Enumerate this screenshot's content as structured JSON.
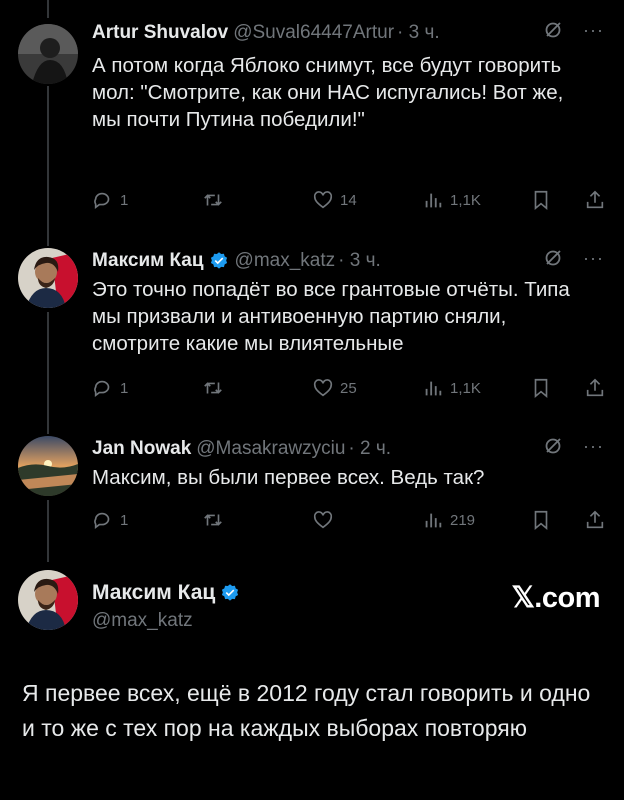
{
  "tweets": [
    {
      "name": "Artur Shuvalov",
      "handle": "@Suval64447Artur",
      "time": "· 3 ч.",
      "text": "А потом когда Яблоко снимут, все будут говорить мол: \"Смотрите, как они НАС испугались! Вот же, мы почти Путина победили!\"",
      "replies": "1",
      "retweets": "",
      "likes": "14",
      "views": "1,1K"
    },
    {
      "name": "Максим Кац",
      "handle": "@max_katz",
      "time": "· 3 ч.",
      "text": "Это точно попадёт во все грантовые отчёты. Типа мы призвали и антивоенную партию сняли, смотрите какие мы влиятельные",
      "replies": "1",
      "retweets": "",
      "likes": "25",
      "views": "1,1K"
    },
    {
      "name": "Jan Nowak",
      "handle": "@Masakrawzyciu",
      "time": "· 2 ч.",
      "text": "Максим, вы были первее всех. Ведь так?",
      "replies": "1",
      "retweets": "",
      "likes": "",
      "views": "219"
    }
  ],
  "main_tweet": {
    "name": "Максим Кац",
    "handle": "@max_katz",
    "logo": "𝕏.com",
    "text": "Я первее всех, ещё в 2012 году стал говорить и одно и то же с тех пор на каждых выборах повторяю"
  },
  "icons": {
    "reply": "reply-icon",
    "retweet": "retweet-icon",
    "like": "heart-icon",
    "views": "views-icon",
    "bookmark": "bookmark-icon",
    "share": "share-icon",
    "grok": "grok-icon",
    "more": "more-icon",
    "verified": "verified-badge-icon"
  },
  "colors": {
    "background": "#000000",
    "text": "#e7e9ea",
    "secondary": "#71767b",
    "verified": "#1d9bf0"
  }
}
